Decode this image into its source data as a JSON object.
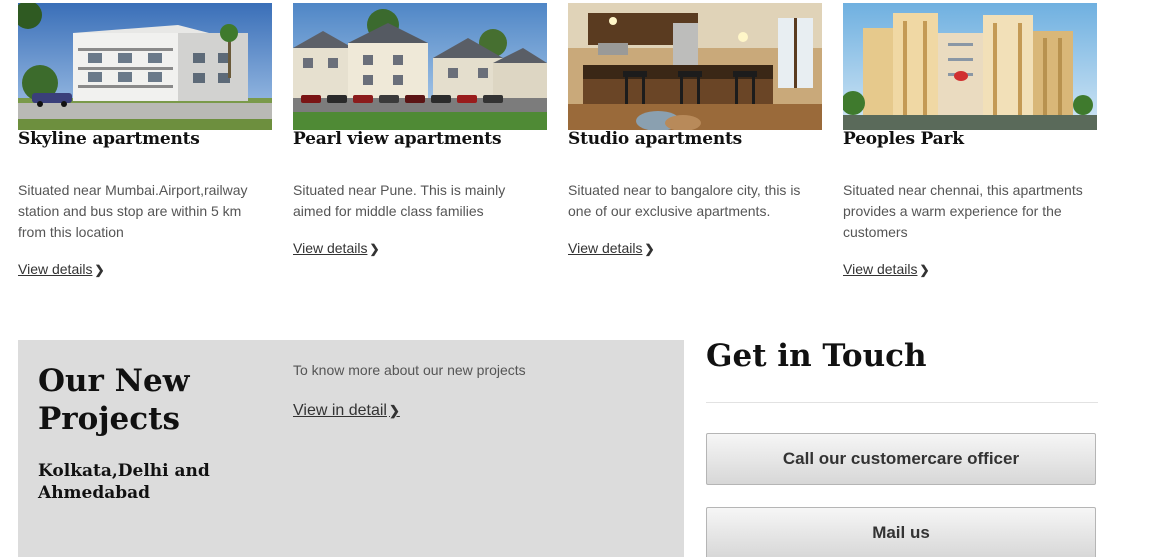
{
  "apartments": [
    {
      "title": "Skyline apartments",
      "description": "Situated near Mumbai.Airport,railway station and bus stop are within 5 km from this location",
      "link_label": "View details",
      "image": "modern-apartment-building-photo"
    },
    {
      "title": "Pearl view apartments",
      "description": "Situated near Pune. This is mainly aimed for middle class families",
      "link_label": "View details",
      "image": "townhouse-complex-photo"
    },
    {
      "title": "Studio apartments",
      "description": "Situated near to bangalore city, this is one of our exclusive apartments.",
      "link_label": "View details",
      "image": "studio-kitchen-interior-photo"
    },
    {
      "title": "Peoples Park",
      "description": "Situated near chennai, this apartments provides a warm experience for the customers",
      "link_label": "View details",
      "image": "high-rise-tower-photo"
    }
  ],
  "projects": {
    "heading": "Our New Projects",
    "cities": "Kolkata,Delhi and Ahmedabad",
    "info": "To know more about our new projects",
    "link_label": "View in detail"
  },
  "contact": {
    "title": "Get in Touch",
    "call_button": "Call our customercare officer",
    "mail_button": "Mail us"
  },
  "icons": {
    "link_chevron": "chevron-right-icon"
  },
  "colors": {
    "panel_bg": "#dcdcdc",
    "heading": "#111111",
    "body_text": "#555555"
  }
}
